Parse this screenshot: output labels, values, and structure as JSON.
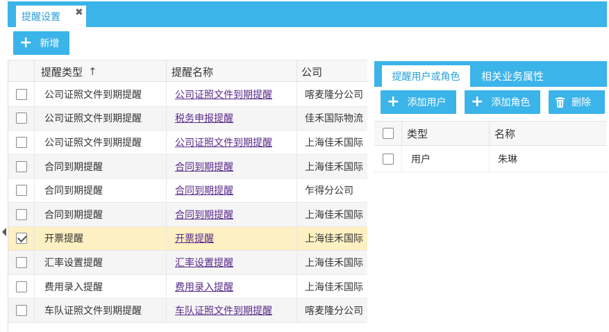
{
  "tabs": {
    "active_label": "提醒设置",
    "close_glyph": "✖"
  },
  "toolbar": {
    "add_label": "新增",
    "add_icon": "plus-icon"
  },
  "left_table": {
    "columns": [
      "提醒类型",
      "提醒名称",
      "公司"
    ],
    "sort_glyph": "↑",
    "rows": [
      {
        "type": "公司证照文件到期提醒",
        "name": "公司证照文件到期提醒",
        "company": "喀麦隆分公司",
        "checked": false
      },
      {
        "type": "公司证照文件到期提醒",
        "name": "税务申报提醒",
        "company": "佳禾国际物流",
        "checked": false
      },
      {
        "type": "公司证照文件到期提醒",
        "name": "公司证照文件到期提醒",
        "company": "上海佳禾国际",
        "checked": false
      },
      {
        "type": "合同到期提醒",
        "name": "合同到期提醒",
        "company": "上海佳禾国际",
        "checked": false
      },
      {
        "type": "合同到期提醒",
        "name": "合同到期提醒",
        "company": "乍得分公司",
        "checked": false
      },
      {
        "type": "合同到期提醒",
        "name": "合同到期提醒",
        "company": "上海佳禾国际",
        "checked": false
      },
      {
        "type": "开票提醒",
        "name": "开票提醒",
        "company": "上海佳禾国际",
        "checked": true
      },
      {
        "type": "汇率设置提醒",
        "name": "汇率设置提醒",
        "company": "上海佳禾国际",
        "checked": false
      },
      {
        "type": "费用录入提醒",
        "name": "费用录入提醒",
        "company": "上海佳禾国际",
        "checked": false
      },
      {
        "type": "车队证照文件到期提醒",
        "name": "车队证照文件到期提醒",
        "company": "喀麦隆分公司",
        "checked": false
      }
    ]
  },
  "right_panel": {
    "tabs": [
      "提醒用户或角色",
      "相关业务属性"
    ],
    "buttons": {
      "add_user": "添加用户",
      "add_role": "添加角色",
      "delete": "删除"
    },
    "columns": [
      "类型",
      "名称"
    ],
    "rows": [
      {
        "type": "用户",
        "name": "朱琳"
      }
    ]
  },
  "colors": {
    "accent": "#3bb4ea",
    "selected_row": "#fdf0c2",
    "link": "#5a2a8a"
  }
}
